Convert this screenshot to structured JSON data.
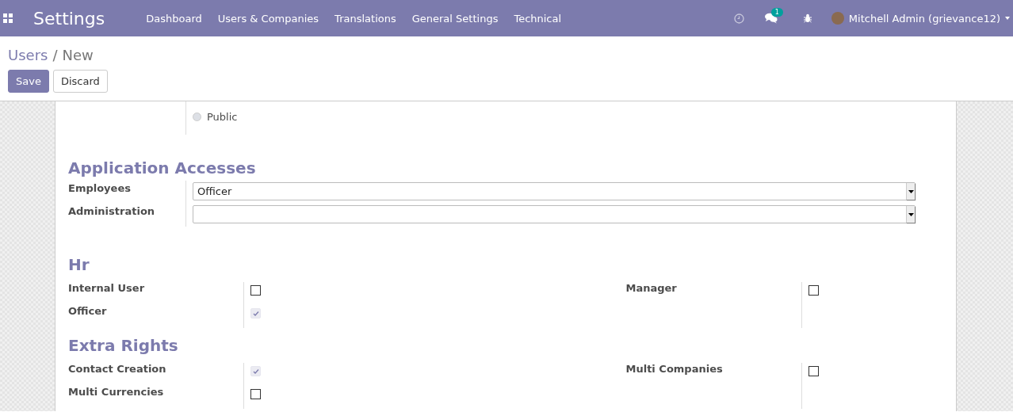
{
  "navbar": {
    "app_title": "Settings",
    "menu": [
      "Dashboard",
      "Users & Companies",
      "Translations",
      "General Settings",
      "Technical"
    ],
    "chat_badge": "1",
    "user_name": "Mitchell Admin (grievance12)"
  },
  "breadcrumb": {
    "parent": "Users",
    "separator": "/",
    "current": "New"
  },
  "buttons": [
    {
      "label": "Save",
      "kind": "primary"
    },
    {
      "label": "Discard",
      "kind": "secondary"
    }
  ],
  "user_type": [
    {
      "label": "Public",
      "selected": false
    }
  ],
  "application_accesses": {
    "title": "Application Accesses",
    "fields": [
      {
        "label": "Employees",
        "value": "Officer"
      },
      {
        "label": "Administration"
      }
    ]
  },
  "groups": [
    {
      "title": "Hr",
      "left": [
        {
          "label": "Internal User",
          "checked": false,
          "disabled": false
        },
        {
          "label": "Officer",
          "checked": true,
          "disabled": true
        }
      ],
      "right": [
        {
          "label": "Manager",
          "checked": false,
          "disabled": false
        }
      ]
    },
    {
      "title": "Extra Rights",
      "left": [
        {
          "label": "Contact Creation",
          "checked": true,
          "disabled": true
        },
        {
          "label": "Multi Currencies",
          "checked": false,
          "disabled": false
        }
      ],
      "right": [
        {
          "label": "Multi Companies",
          "checked": false,
          "disabled": false
        }
      ]
    }
  ]
}
